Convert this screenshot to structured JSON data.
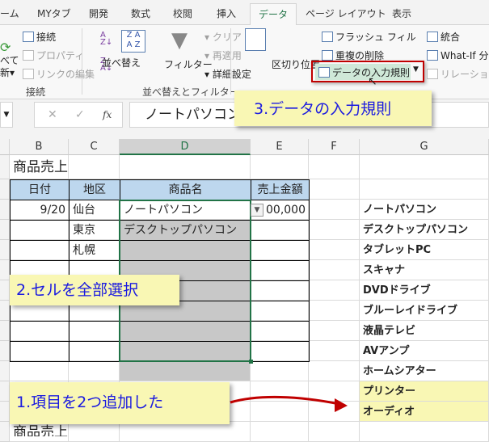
{
  "tabs": [
    "ーム",
    "MYタブ",
    "開発",
    "数式",
    "校閲",
    "挿入",
    "データ",
    "ページ レイアウト",
    "表示"
  ],
  "ribbon": {
    "connections": {
      "refresh_all_line1": "べて",
      "refresh_all_line2": "新",
      "connections": "接続",
      "properties": "プロパティ",
      "edit_links": "リンクの編集",
      "group": "接続"
    },
    "sort_filter": {
      "sort": "並べ替え",
      "filter": "フィルター",
      "clear": "クリア",
      "reapply": "再適用",
      "advanced": "詳細設定",
      "group": "並べ替えとフィルター"
    },
    "data_tools": {
      "text_to_columns": "区切り位置",
      "flash_fill": "フラッシュ フィル",
      "remove_duplicates": "重複の削除",
      "data_validation": "データの入力規則",
      "consolidate": "統合",
      "what_if": "What-If 分",
      "relationships": "リレーションシ"
    }
  },
  "formula_bar": {
    "fx": "fx",
    "value": "ノートパソコン"
  },
  "columns": [
    "B",
    "C",
    "D",
    "E",
    "F",
    "G"
  ],
  "sheet": {
    "title": "商品売上",
    "headers": [
      "日付",
      "地区",
      "商品名",
      "売上金額"
    ],
    "rows": [
      [
        "9/20",
        "仙台",
        "ノートパソコン",
        "00,000"
      ],
      [
        "",
        "東京",
        "デスクトップパソコン",
        ""
      ],
      [
        "",
        "札幌",
        "",
        ""
      ]
    ],
    "list": [
      "ノートパソコン",
      "デスクトップパソコン",
      "タブレットPC",
      "スキャナ",
      "DVDドライブ",
      "ブルーレイドライブ",
      "液晶テレビ",
      "AVアンプ",
      "ホームシアター",
      "プリンター",
      "オーディオ"
    ],
    "bottom_partial": "商品売上"
  },
  "callouts": {
    "step1": "1.項目を2つ追加した",
    "step2": "2.セルを全部選択",
    "step3": "3.データの入力規則"
  },
  "colors": {
    "accent": "#217346",
    "callout_bg": "#f9f7b4",
    "callout_text": "#1a1ae0",
    "header_fill": "#bdd7ee",
    "selection": "#c8c8c8",
    "highlight_border": "#c00000"
  }
}
